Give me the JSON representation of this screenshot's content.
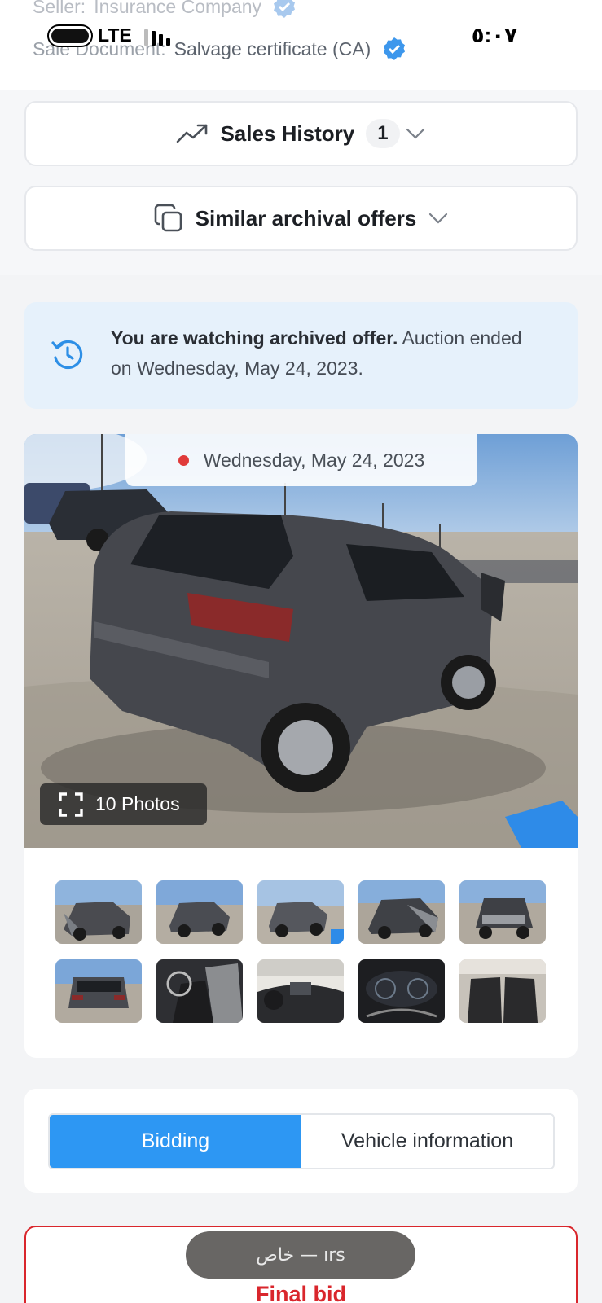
{
  "status_bar": {
    "network": "LTE",
    "time": "٥:٠٧"
  },
  "seller": {
    "label": "Seller:",
    "value": "Insurance Company"
  },
  "sale_document": {
    "label": "Sale Document:",
    "value": "Salvage certificate (CA)"
  },
  "accordions": [
    {
      "title": "Sales History",
      "count": "1",
      "icon": "trend-up-icon"
    },
    {
      "title": "Similar archival offers",
      "icon": "copy-icon"
    }
  ],
  "notice": {
    "bold": "You are watching archived offer.",
    "text": " Auction ended on Wednesday, May 24, 2023.",
    "icon": "history-icon",
    "color": "#e6f1fb"
  },
  "gallery": {
    "date": "Wednesday, May 24, 2023",
    "photos_label": "10 Photos",
    "thumbnails": [
      "front-damage",
      "rear-three-quarter",
      "rear-view",
      "front-left",
      "front-damage-2",
      "rear",
      "driver-interior",
      "dashboard-center",
      "instrument-cluster",
      "rear-seats"
    ]
  },
  "tabs": {
    "active": "Bidding",
    "inactive": "Vehicle information",
    "accent": "#2d97f3"
  },
  "final_bid": {
    "label": "Final bid",
    "color": "#d9262c"
  },
  "toast": {
    "text": "خاص — ırs"
  }
}
